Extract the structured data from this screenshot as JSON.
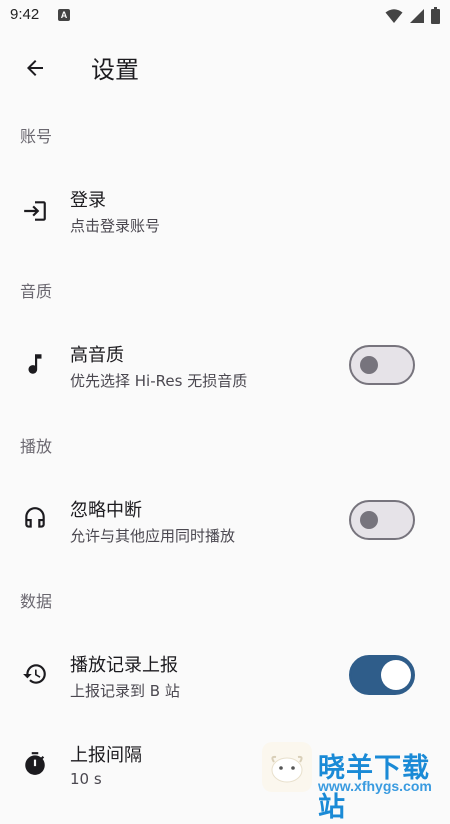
{
  "status_bar": {
    "time": "9:42",
    "notification_letter": "A"
  },
  "app_bar": {
    "title": "设置"
  },
  "sections": {
    "account": "账号",
    "quality": "音质",
    "playback": "播放",
    "data": "数据"
  },
  "prefs": {
    "login": {
      "title": "登录",
      "summary": "点击登录账号",
      "icon": "login-icon"
    },
    "hires": {
      "title": "高音质",
      "summary": "优先选择 Hi-Res 无损音质",
      "icon": "music-note-icon",
      "enabled": false
    },
    "ignore_interrupt": {
      "title": "忽略中断",
      "summary": "允许与其他应用同时播放",
      "icon": "headphones-icon",
      "enabled": false
    },
    "report_history": {
      "title": "播放记录上报",
      "summary": "上报记录到 B 站",
      "icon": "history-icon",
      "enabled": true
    },
    "report_interval": {
      "title": "上报间隔",
      "summary": "10 s",
      "icon": "timer-icon"
    }
  },
  "colors": {
    "accent": "#2f5d8a",
    "switch_off": "#77747d",
    "background": "#fafafa"
  },
  "watermark": {
    "name": "晓羊下载站",
    "url": "www.xfhygs.com"
  }
}
